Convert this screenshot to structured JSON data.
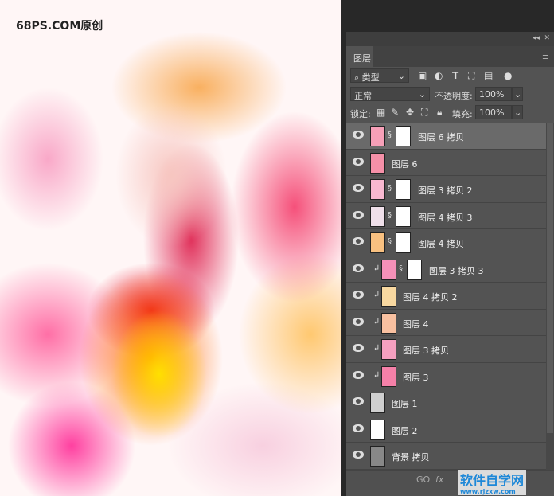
{
  "watermark_top": "68PS.COM原创",
  "watermark_bottom": {
    "title": "软件自学网",
    "url": "www.rjzxw.com",
    "logo": "RJ"
  },
  "panel": {
    "tab": "图层",
    "filter": {
      "value": "类型",
      "icons": [
        "image-filter-icon",
        "adjustment-filter-icon",
        "type-filter-icon",
        "shape-filter-icon",
        "smart-object-filter-icon",
        "filter-toggle"
      ]
    },
    "blend_mode": "正常",
    "opacity_label": "不透明度:",
    "opacity": "100%",
    "lock_label": "锁定:",
    "fill_label": "填充:",
    "fill": "100%",
    "layers": [
      {
        "name": "图层 6 拷贝",
        "mask": true,
        "clip": false,
        "active": true,
        "thumb": "#f7a0b8"
      },
      {
        "name": "图层 6",
        "mask": false,
        "clip": false,
        "thumb": "#f590a8"
      },
      {
        "name": "图层 3 拷贝 2",
        "mask": true,
        "clip": false,
        "thumb": "#f8b8d0"
      },
      {
        "name": "图层 4 拷贝 3",
        "mask": true,
        "clip": false,
        "thumb": "#f0e0ea"
      },
      {
        "name": "图层 4 拷贝",
        "mask": true,
        "clip": false,
        "thumb": "#f8c080"
      },
      {
        "name": "图层 3 拷贝 3",
        "mask": true,
        "clip": true,
        "thumb": "#f590b8"
      },
      {
        "name": "图层 4 拷贝 2",
        "mask": false,
        "clip": true,
        "thumb": "#f8d8a0"
      },
      {
        "name": "图层 4",
        "mask": false,
        "clip": true,
        "thumb": "#f8c0a0"
      },
      {
        "name": "图层 3 拷贝",
        "mask": false,
        "clip": true,
        "thumb": "#f5a0c0"
      },
      {
        "name": "图层 3",
        "mask": false,
        "clip": true,
        "thumb": "#f580a8"
      },
      {
        "name": "图层 1",
        "mask": false,
        "clip": false,
        "thumb": "#cfcfcf"
      },
      {
        "name": "图层 2",
        "mask": false,
        "clip": false,
        "thumb": "#ffffff"
      },
      {
        "name": "背景 拷贝",
        "mask": false,
        "clip": false,
        "thumb": "#888888"
      }
    ],
    "footer": {
      "link": "GO",
      "fx": "fx"
    }
  }
}
